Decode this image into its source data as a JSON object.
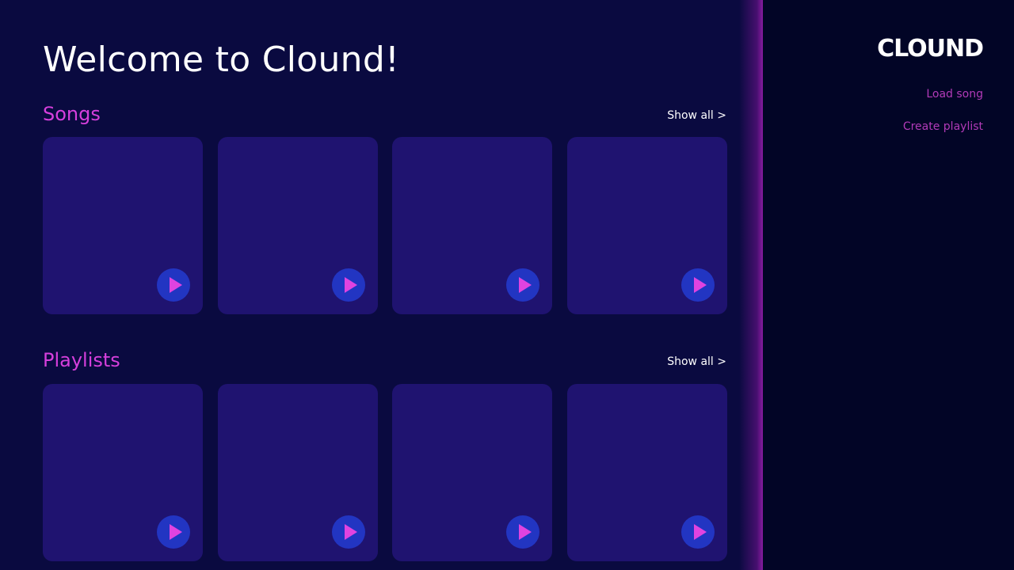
{
  "main": {
    "title": "Welcome to Clound!",
    "sections": [
      {
        "title": "Songs",
        "show_all_label": "Show all >",
        "cards": [
          {},
          {},
          {},
          {}
        ]
      },
      {
        "title": "Playlists",
        "show_all_label": "Show all >",
        "cards": [
          {},
          {},
          {},
          {}
        ]
      }
    ]
  },
  "sidebar": {
    "logo_text": "CLOUND",
    "links": [
      {
        "label": "Load song"
      },
      {
        "label": "Create playlist"
      }
    ]
  },
  "colors": {
    "main_background": "#0a0a40",
    "sidebar_background": "#020526",
    "card_background": "#1f1370",
    "accent": "#d63fdc",
    "play_button": "#2235c2",
    "play_icon": "#e043e0"
  },
  "icons": {
    "play": "play-icon"
  }
}
